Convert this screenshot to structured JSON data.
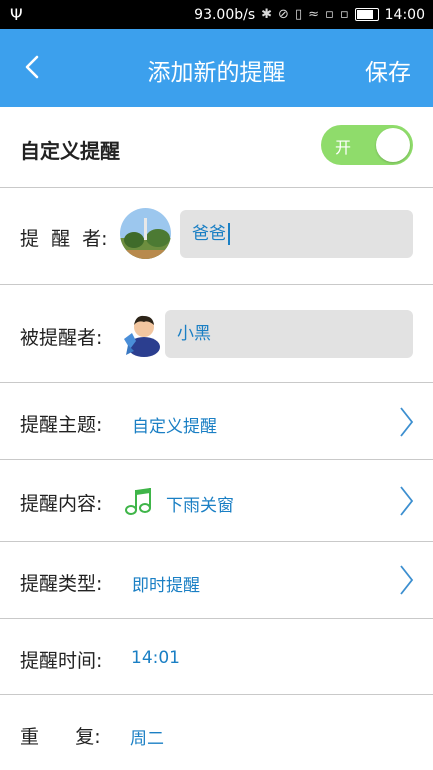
{
  "status_bar": {
    "usb_icon": "usb-icon",
    "speed": "93.00b/s",
    "time": "14:00"
  },
  "header": {
    "back_icon": "chevron-left-icon",
    "title": "添加新的提醒",
    "save_label": "保存"
  },
  "custom_reminder": {
    "label": "自定义提醒",
    "toggle_label": "开",
    "toggle_on": true
  },
  "reminder_sender": {
    "label": "提  醒  者:",
    "value": "爸爸"
  },
  "reminder_receiver": {
    "label": "被提醒者:",
    "value": "小黑"
  },
  "reminder_topic": {
    "label": "提醒主题:",
    "value": "自定义提醒"
  },
  "reminder_content": {
    "label": "提醒内容:",
    "value": "下雨关窗",
    "icon": "music-note-icon"
  },
  "reminder_type": {
    "label": "提醒类型:",
    "value": "即时提醒"
  },
  "reminder_time": {
    "label": "提醒时间:",
    "value": "14:01"
  },
  "repeat": {
    "label": "重      复:",
    "value": "周二"
  },
  "colors": {
    "nav_bg": "#3ca0ed",
    "value_text": "#1a7fc4",
    "toggle_on": "#8fdc6b",
    "music_icon": "#3fb549"
  }
}
